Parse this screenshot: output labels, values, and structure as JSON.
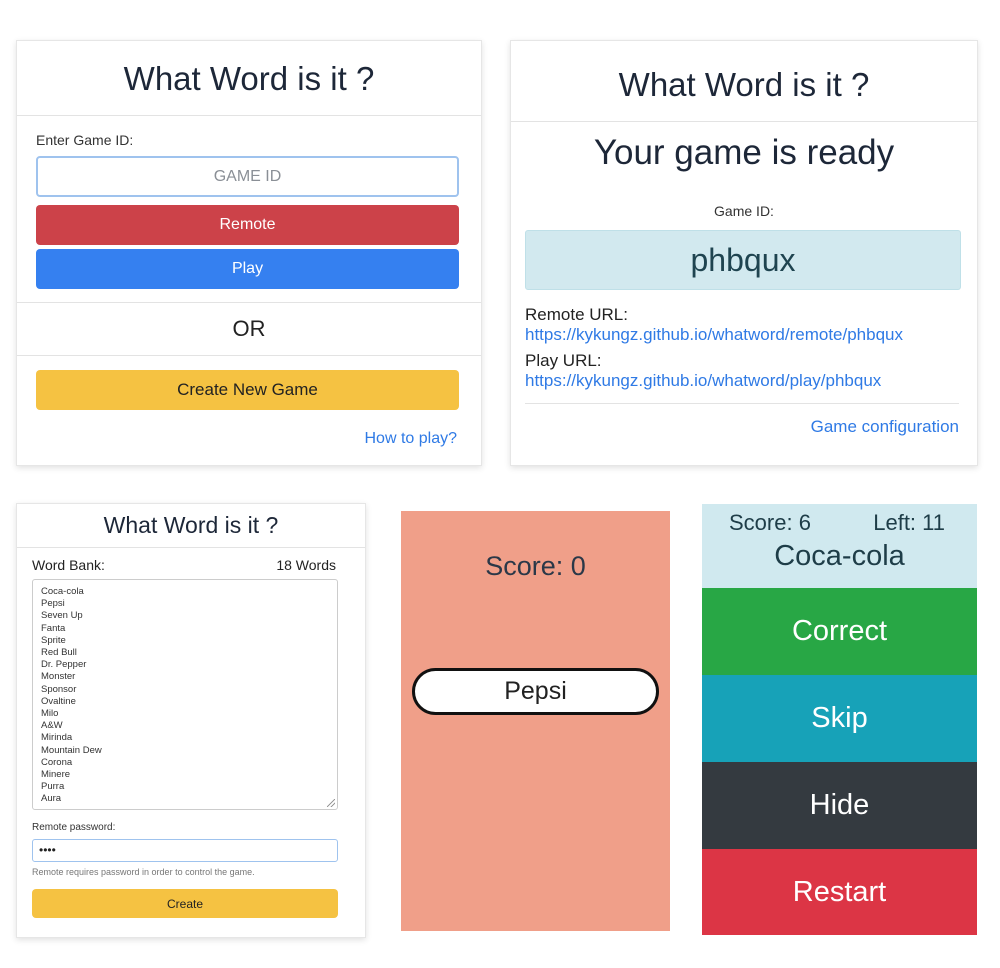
{
  "panel_home": {
    "title": "What Word is it ?",
    "game_id_label": "Enter Game ID:",
    "game_id_placeholder": "GAME ID",
    "remote_label": "Remote",
    "play_label": "Play",
    "or_label": "OR",
    "create_label": "Create New Game",
    "how_to_label": "How to play?"
  },
  "panel_ready": {
    "title": "What Word is it ?",
    "heading": "Your game is ready",
    "game_id_label": "Game ID:",
    "game_id": "phbqux",
    "remote_url_label": "Remote URL:",
    "remote_url": "https://kykungz.github.io/whatword/remote/phbqux",
    "play_url_label": "Play URL:",
    "play_url": "https://kykungz.github.io/whatword/play/phbqux",
    "config_label": "Game configuration"
  },
  "panel_config": {
    "title": "What Word is it ?",
    "word_bank_label": "Word Bank:",
    "word_count": "18 Words",
    "words": [
      "Coca-cola",
      "Pepsi",
      "Seven Up",
      "Fanta",
      "Sprite",
      "Red Bull",
      "Dr. Pepper",
      "Monster",
      "Sponsor",
      "Ovaltine",
      "Milo",
      "A&W",
      "Mirinda",
      "Mountain Dew",
      "Corona",
      "Minere",
      "Purra",
      "Aura"
    ],
    "password_label": "Remote password:",
    "password_value": "••••",
    "password_hint": "Remote requires password in order to control the game.",
    "create_label": "Create"
  },
  "panel_play": {
    "score": "Score: 0",
    "word": "Pepsi"
  },
  "panel_remote": {
    "score": "Score: 6",
    "left": "Left: 11",
    "word": "Coca-cola",
    "correct_label": "Correct",
    "skip_label": "Skip",
    "hide_label": "Hide",
    "restart_label": "Restart"
  },
  "colors": {
    "remote": "#cc4249",
    "play": "#3580f0",
    "create": "#f5c242",
    "play_bg": "#f09f89",
    "correct": "#28a745",
    "skip": "#17a2b8",
    "hide": "#343a40",
    "restart": "#dc3545"
  }
}
